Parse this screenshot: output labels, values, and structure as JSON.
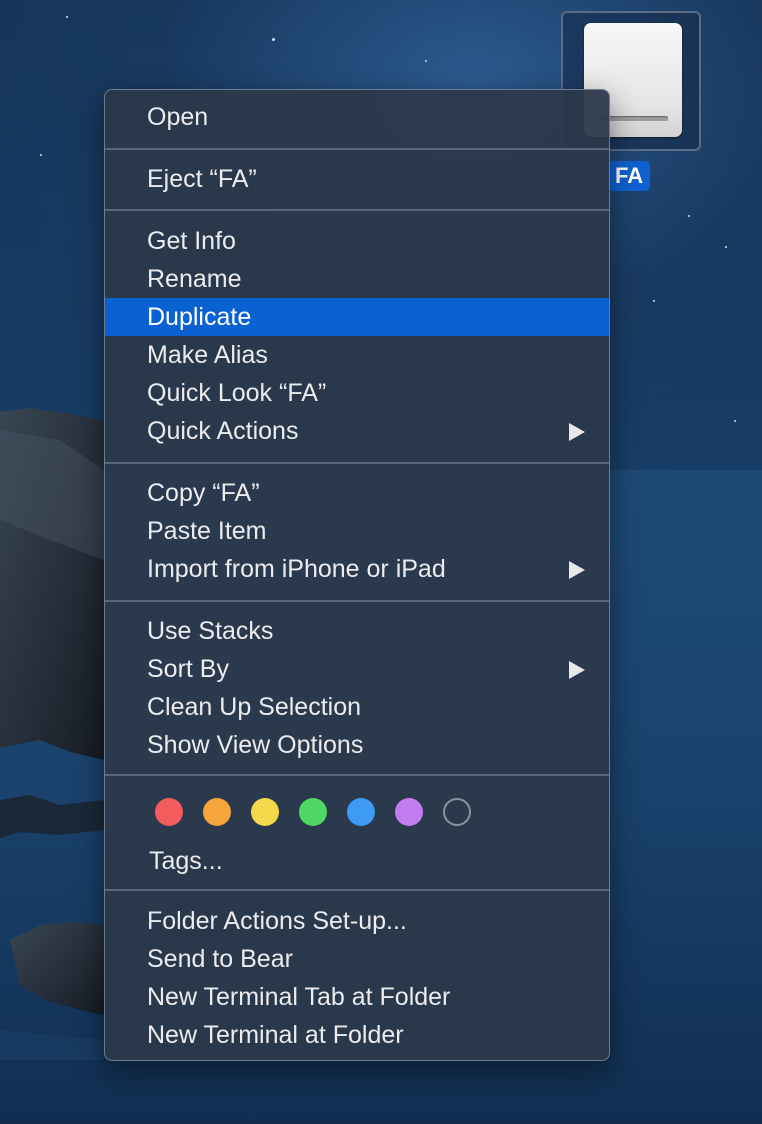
{
  "desktop": {
    "drive": {
      "label": "FA",
      "icon": "external-drive-icon"
    }
  },
  "context_menu": {
    "groups": [
      {
        "items": [
          {
            "label": "Open"
          }
        ]
      },
      {
        "items": [
          {
            "label": "Eject “FA”"
          }
        ]
      },
      {
        "items": [
          {
            "label": "Get Info"
          },
          {
            "label": "Rename"
          },
          {
            "label": "Duplicate",
            "selected": true
          },
          {
            "label": "Make Alias"
          },
          {
            "label": "Quick Look “FA”"
          },
          {
            "label": "Quick Actions",
            "submenu": true
          }
        ]
      },
      {
        "items": [
          {
            "label": "Copy “FA”"
          },
          {
            "label": "Paste Item"
          },
          {
            "label": "Import from iPhone or iPad",
            "submenu": true
          }
        ]
      },
      {
        "items": [
          {
            "label": "Use Stacks"
          },
          {
            "label": "Sort By",
            "submenu": true
          },
          {
            "label": "Clean Up Selection"
          },
          {
            "label": "Show View Options"
          }
        ]
      },
      {
        "items": [
          {
            "label": "Tags..."
          }
        ]
      },
      {
        "items": [
          {
            "label": "Folder Actions Set-up..."
          },
          {
            "label": "Send to Bear"
          },
          {
            "label": "New Terminal Tab at Folder"
          },
          {
            "label": "New Terminal at Folder"
          }
        ]
      }
    ],
    "tags": [
      {
        "name": "red",
        "color": "#f25c5c"
      },
      {
        "name": "orange",
        "color": "#f6a43c"
      },
      {
        "name": "yellow",
        "color": "#f5d84a"
      },
      {
        "name": "green",
        "color": "#4fd866"
      },
      {
        "name": "blue",
        "color": "#3d9bf5"
      },
      {
        "name": "purple",
        "color": "#c57bf0"
      },
      {
        "name": "none",
        "color": "#8a929e"
      }
    ],
    "colors": {
      "highlight": "#0a62d2",
      "text": "#ececee"
    }
  }
}
